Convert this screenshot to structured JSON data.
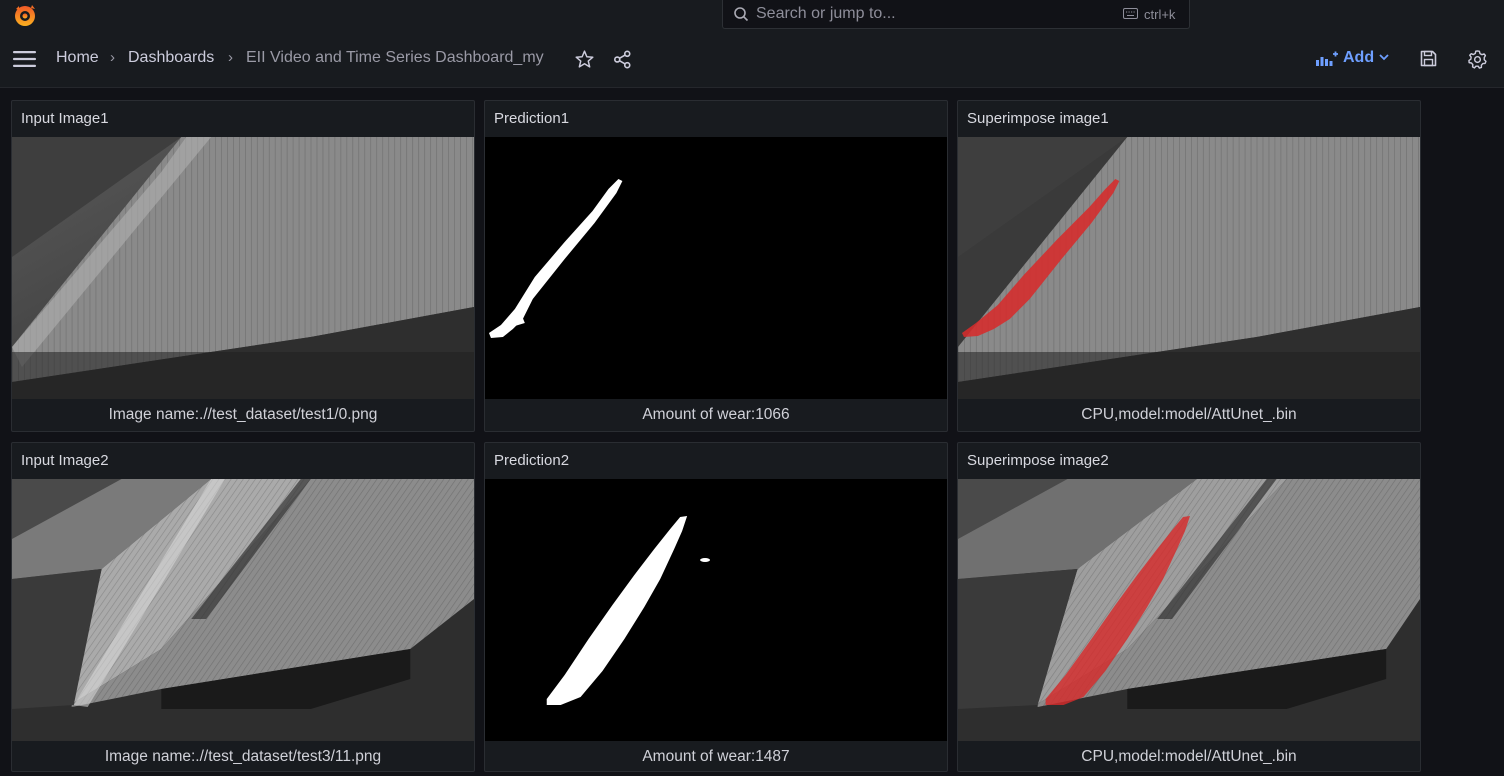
{
  "search": {
    "placeholder": "Search or jump to...",
    "shortcut": "ctrl+k"
  },
  "breadcrumb": {
    "home": "Home",
    "dashboards": "Dashboards",
    "current": "EII Video and Time Series Dashboard_my"
  },
  "toolbar": {
    "add_label": "Add"
  },
  "panels": [
    {
      "title": "Input Image1",
      "caption": "Image name:.//test_dataset/test1/0.png"
    },
    {
      "title": "Prediction1",
      "caption": "Amount of wear:1066"
    },
    {
      "title": "Superimpose image1",
      "caption": "CPU,model:model/AttUnet_.bin"
    },
    {
      "title": "Input Image2",
      "caption": "Image name:.//test_dataset/test3/11.png"
    },
    {
      "title": "Prediction2",
      "caption": "Amount of wear:1487"
    },
    {
      "title": "Superimpose image2",
      "caption": "CPU,model:model/AttUnet_.bin"
    }
  ],
  "colors": {
    "accent": "#6e9fff",
    "wear_overlay": "#d62b2b",
    "background": "#111217",
    "panel": "#181b1f"
  }
}
